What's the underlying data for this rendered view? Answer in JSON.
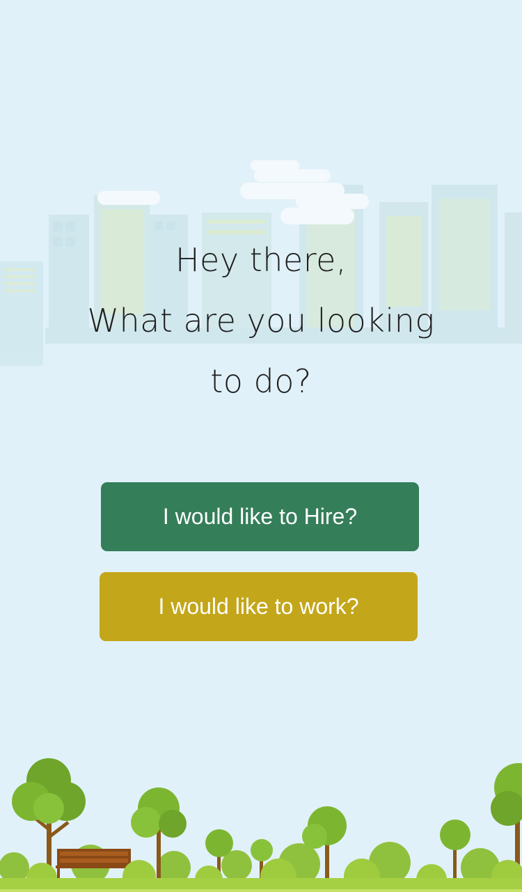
{
  "greeting": {
    "line1": "Hey there,",
    "line2": "What are you looking",
    "line3": "to do?"
  },
  "actions": {
    "hire_label": "I would like to Hire?",
    "work_label": "I would like to work?"
  },
  "colors": {
    "background": "#e1f1f9",
    "hire_button": "#357e5a",
    "work_button": "#c4a61a",
    "text": "#1e1e1e"
  }
}
